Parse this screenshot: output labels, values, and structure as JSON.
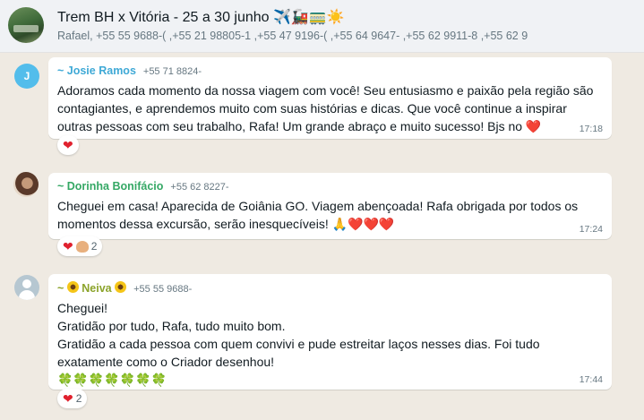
{
  "header": {
    "title": "Trem BH x Vitória - 25 a 30 junho ✈️🚂🚃☀️",
    "members": "Rafael, +55 55 9688-(    ,+55 21 98805-1    ,+55 47 9196-(    ,+55 64 9647-    ,+55 62 9911-8    ,+55 62 9"
  },
  "messages": [
    {
      "avatar_letter": "J",
      "sender": "~ Josie Ramos",
      "sender_color": "#3fa9d6",
      "phone": "+55 71 8824-",
      "text": "Adoramos cada momento da nossa viagem com você! Seu entusiasmo e paixão pela região são contagiantes, e aprendemos muito com suas histórias e dicas. Que você continue a inspirar outras pessoas com seu trabalho, Rafa! Um grande abraço e muito sucesso! Bjs no ❤️",
      "time": "17:18",
      "reaction": {
        "emoji": "❤",
        "count": ""
      }
    },
    {
      "sender": "~ Dorinha Bonifácio",
      "sender_color": "#35a865",
      "phone": "+55 62 8227-",
      "text": "Cheguei em casa! Aparecida de Goiânia GO. Viagem abençoada! Rafa obrigada por todos os momentos dessa excursão, serão inesquecíveis! 🙏❤️❤️❤️",
      "time": "17:24",
      "reaction": {
        "emoji": "❤",
        "count": "2"
      }
    },
    {
      "sender_prefix": "~",
      "sender": "Neiva",
      "sender_color": "#8ba32a",
      "phone": "+55 55 9688-",
      "text": "Cheguei!\nGratidão por tudo, Rafa, tudo muito bom.\nGratidão a cada pessoa com quem convivi e pude estreitar laços nesses dias. Foi tudo exatamente como o Criador desenhou!\n🍀🍀🍀🍀🍀🍀🍀",
      "time": "17:44",
      "reaction": {
        "emoji": "❤",
        "count": "2"
      }
    }
  ]
}
